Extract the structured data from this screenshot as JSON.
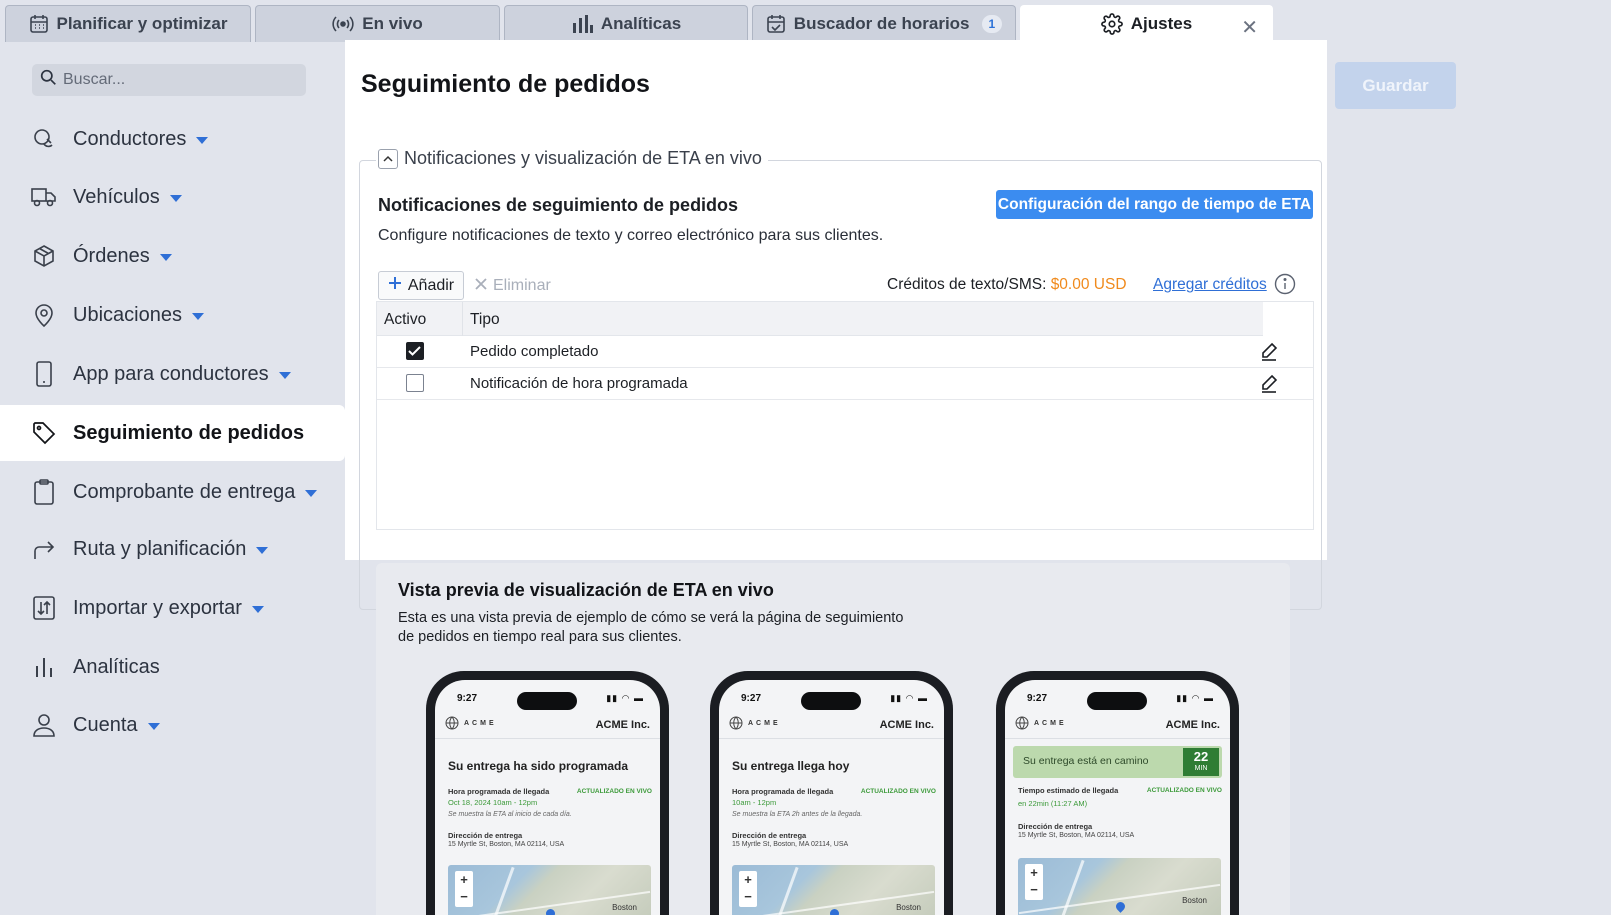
{
  "tabs": [
    {
      "label": "Planificar y optimizar",
      "icon": "calendar-grid-icon"
    },
    {
      "label": "En vivo",
      "icon": "broadcast-icon"
    },
    {
      "label": "Analíticas",
      "icon": "bar-chart-icon"
    },
    {
      "label": "Buscador de horarios",
      "icon": "calendar-check-icon",
      "badge": "1"
    },
    {
      "label": "Ajustes",
      "icon": "gear-icon",
      "active": true
    }
  ],
  "sidebar": {
    "search_placeholder": "Buscar...",
    "items": [
      {
        "label": "Conductores",
        "icon": "steering-wheel-icon"
      },
      {
        "label": "Vehículos",
        "icon": "truck-icon"
      },
      {
        "label": "Órdenes",
        "icon": "box-icon"
      },
      {
        "label": "Ubicaciones",
        "icon": "map-pin-icon"
      },
      {
        "label": "App para conductores",
        "icon": "phone-icon"
      },
      {
        "label": "Seguimiento de pedidos",
        "icon": "tag-icon",
        "active": true
      },
      {
        "label": "Comprobante de entrega",
        "icon": "clipboard-icon"
      },
      {
        "label": "Ruta y planificación",
        "icon": "route-arrow-icon"
      },
      {
        "label": "Importar y exportar",
        "icon": "import-export-icon"
      },
      {
        "label": "Analíticas",
        "icon": "bar-chart-icon"
      },
      {
        "label": "Cuenta",
        "icon": "user-icon"
      }
    ]
  },
  "main": {
    "title": "Seguimiento de pedidos",
    "save_label": "Guardar",
    "section_legend": "Notificaciones y visualización de ETA en vivo",
    "section_title": "Notificaciones de seguimiento de pedidos",
    "section_desc": "Configure notificaciones de texto y correo electrónico para sus clientes.",
    "eta_range_button": "Configuración del rango de tiempo de ETA",
    "add_label": "Añadir",
    "delete_label": "Eliminar",
    "credits_label": "Créditos de texto/SMS:",
    "credits_amount": "$0.00 USD",
    "add_credits_label": "Agregar créditos",
    "table": {
      "headers": [
        "Activo",
        "Tipo"
      ],
      "rows": [
        {
          "active": true,
          "type": "Pedido completado"
        },
        {
          "active": false,
          "type": "Notificación de hora programada"
        }
      ]
    }
  },
  "preview": {
    "title": "Vista previa de visualización de ETA en vivo",
    "desc_line1": "Esta es una vista previa de ejemplo de cómo se verá la página de seguimiento",
    "desc_line2": "de pedidos en tiempo real para sus clientes.",
    "phones": [
      {
        "time": "9:27",
        "brand": "ACME",
        "company": "ACME Inc.",
        "heading": "Su entrega ha sido programada",
        "arrival_label": "Hora programada de llegada",
        "live": "ACTUALIZADO EN VIVO",
        "arrival_value": "Oct 18, 2024 10am - 12pm",
        "note": "Se muestra la ETA al inicio de cada día.",
        "address_label": "Dirección de entrega",
        "address": "15 Myrtle St, Boston, MA 02114, USA",
        "map_label": "Boston"
      },
      {
        "time": "9:27",
        "brand": "ACME",
        "company": "ACME Inc.",
        "heading": "Su entrega llega hoy",
        "arrival_label": "Hora programada de llegada",
        "live": "ACTUALIZADO EN VIVO",
        "arrival_value": "10am - 12pm",
        "note": "Se muestra la ETA 2h antes de la llegada.",
        "address_label": "Dirección de entrega",
        "address": "15 Myrtle St, Boston, MA 02114, USA",
        "map_label": "Boston"
      },
      {
        "time": "9:27",
        "brand": "ACME",
        "company": "ACME Inc.",
        "heading": "Su entrega está en camino",
        "eta_minutes": "22",
        "eta_unit": "MIN",
        "arrival_label": "Tiempo estimado de llegada",
        "live": "ACTUALIZADO EN VIVO",
        "arrival_value": "en 22min (11:27 AM)",
        "address_label": "Dirección de entrega",
        "address": "15 Myrtle St, Boston, MA 02114, USA",
        "map_label": "Boston"
      }
    ]
  },
  "colors": {
    "accent": "#3b8cf0",
    "credits": "#f08a1c",
    "live_green": "#3c9a3a"
  }
}
